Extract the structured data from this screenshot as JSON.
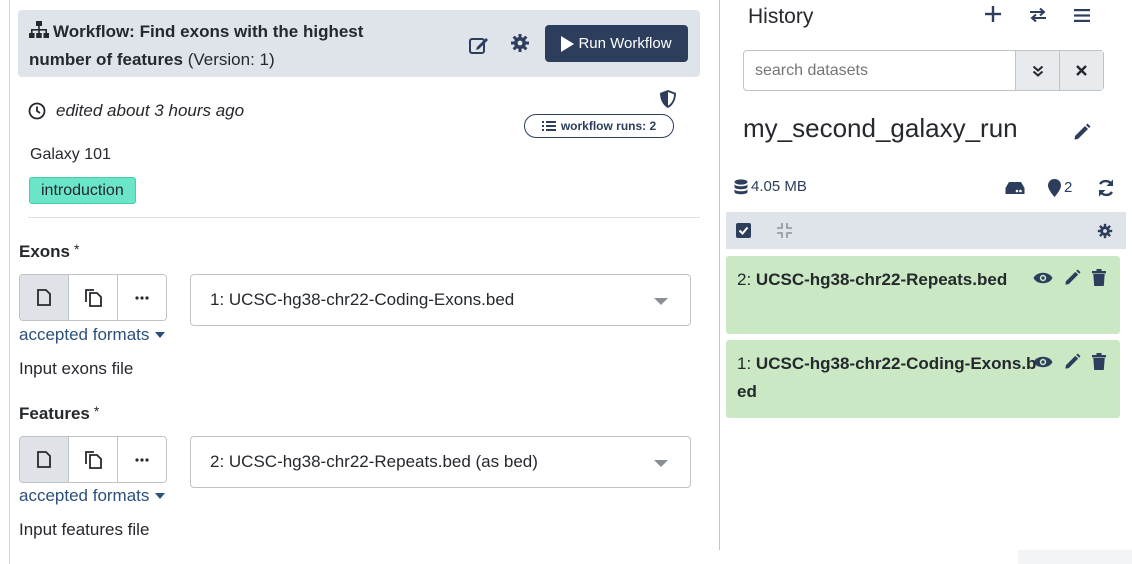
{
  "workflow": {
    "title_bold": "Workflow: Find exons with the highest number of features",
    "version": "(Version: 1)",
    "run_label": "Run Workflow",
    "edited": "edited about 3 hours ago",
    "runs_badge": "workflow runs: 2",
    "annotation": "Galaxy 101",
    "tag": "introduction"
  },
  "params": [
    {
      "label": "Exons",
      "required": "*",
      "value": "1: UCSC-hg38-chr22-Coding-Exons.bed",
      "accepted": "accepted formats",
      "help": "Input exons file"
    },
    {
      "label": "Features",
      "required": "*",
      "value": "2: UCSC-hg38-chr22-Repeats.bed (as bed)",
      "accepted": "accepted formats",
      "help": "Input features file"
    }
  ],
  "history": {
    "title": "History",
    "search_placeholder": "search datasets",
    "name": "my_second_galaxy_run",
    "size": "4.05 MB",
    "storage_count": "2",
    "datasets": [
      {
        "hid": "2:",
        "name": "UCSC-hg38-chr22-Repeats.bed"
      },
      {
        "hid": "1:",
        "name": "UCSC-hg38-chr22-Coding-Exons.bed"
      }
    ]
  },
  "colors": {
    "accent": "#2c3e5c",
    "tag": "#6ae5c8",
    "dataset_ok": "#c9e8c3",
    "header_bg": "#dfe4ea"
  }
}
